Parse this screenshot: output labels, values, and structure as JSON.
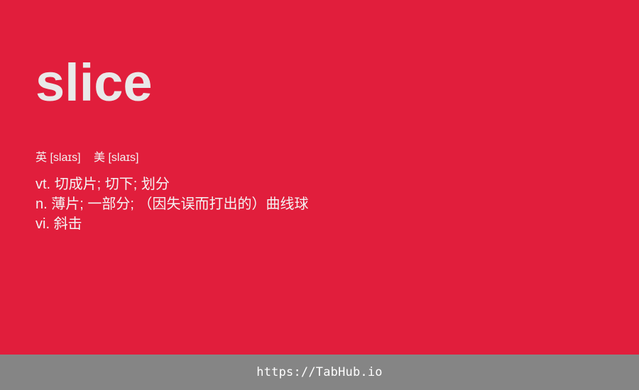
{
  "word": "slice",
  "phonetics": [
    {
      "label": "英",
      "ipa": "[slaɪs]"
    },
    {
      "label": "美",
      "ipa": "[slaɪs]"
    }
  ],
  "definitions": [
    {
      "pos": "vt.",
      "meaning": "切成片; 切下; 划分"
    },
    {
      "pos": "n.",
      "meaning": "薄片; 一部分; （因失误而打出的）曲线球"
    },
    {
      "pos": "vi.",
      "meaning": "斜击"
    }
  ],
  "footer": {
    "link_text": "https://TabHub.io"
  },
  "colors": {
    "background": "#e11e3c",
    "footer": "#858585",
    "word": "#e9e9e9"
  }
}
